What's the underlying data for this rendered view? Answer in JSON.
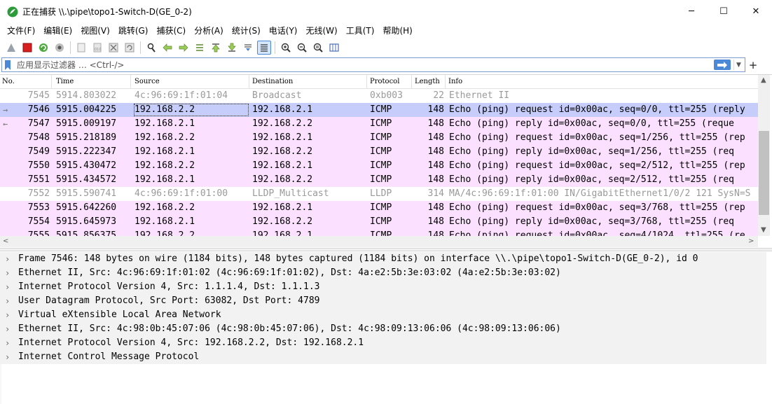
{
  "window": {
    "title": "正在捕获 \\\\.\\pipe\\topo1-Switch-D(GE_0-2)",
    "controls": [
      "─",
      "☐",
      "✕"
    ]
  },
  "menu": [
    "文件(F)",
    "编辑(E)",
    "视图(V)",
    "跳转(G)",
    "捕获(C)",
    "分析(A)",
    "统计(S)",
    "电话(Y)",
    "无线(W)",
    "工具(T)",
    "帮助(H)"
  ],
  "toolbar": {
    "buttons": [
      "start-capture-icon",
      "stop-capture-icon",
      "restart-capture-icon",
      "capture-options-icon",
      "open-file-icon",
      "save-file-icon",
      "close-file-icon",
      "reload-file-icon",
      "find-packet-icon",
      "go-back-icon",
      "go-forward-icon",
      "go-to-packet-icon",
      "go-first-icon",
      "go-last-icon",
      "auto-scroll-icon",
      "colorize-icon",
      "zoom-in-icon",
      "zoom-out-icon",
      "zoom-normal-icon",
      "resize-columns-icon"
    ]
  },
  "filter": {
    "placeholder": "应用显示过滤器 … <Ctrl-/>"
  },
  "packet_list": {
    "columns": [
      "No.",
      "Time",
      "Source",
      "Destination",
      "Protocol",
      "Length",
      "Info"
    ],
    "rows": [
      {
        "no": "7545",
        "time": "5914.803022",
        "src": "4c:96:69:1f:01:04",
        "dst": "Broadcast",
        "proto": "0xb003",
        "len": "22",
        "info": "Ethernet II",
        "style": "faded",
        "marker": ""
      },
      {
        "no": "7546",
        "time": "5915.004225",
        "src": "192.168.2.2",
        "dst": "192.168.2.1",
        "proto": "ICMP",
        "len": "148",
        "info": "Echo (ping) request  id=0x00ac, seq=0/0, ttl=255 (reply",
        "style": "selected",
        "marker": "→"
      },
      {
        "no": "7547",
        "time": "5915.009197",
        "src": "192.168.2.1",
        "dst": "192.168.2.2",
        "proto": "ICMP",
        "len": "148",
        "info": "Echo (ping) reply    id=0x00ac, seq=0/0, ttl=255 (reque",
        "style": "icmp",
        "marker": "←"
      },
      {
        "no": "7548",
        "time": "5915.218189",
        "src": "192.168.2.2",
        "dst": "192.168.2.1",
        "proto": "ICMP",
        "len": "148",
        "info": "Echo (ping) request  id=0x00ac, seq=1/256, ttl=255 (rep",
        "style": "icmp",
        "marker": ""
      },
      {
        "no": "7549",
        "time": "5915.222347",
        "src": "192.168.2.1",
        "dst": "192.168.2.2",
        "proto": "ICMP",
        "len": "148",
        "info": "Echo (ping) reply    id=0x00ac, seq=1/256, ttl=255 (req",
        "style": "icmp",
        "marker": ""
      },
      {
        "no": "7550",
        "time": "5915.430472",
        "src": "192.168.2.2",
        "dst": "192.168.2.1",
        "proto": "ICMP",
        "len": "148",
        "info": "Echo (ping) request  id=0x00ac, seq=2/512, ttl=255 (rep",
        "style": "icmp",
        "marker": ""
      },
      {
        "no": "7551",
        "time": "5915.434572",
        "src": "192.168.2.1",
        "dst": "192.168.2.2",
        "proto": "ICMP",
        "len": "148",
        "info": "Echo (ping) reply    id=0x00ac, seq=2/512, ttl=255 (req",
        "style": "icmp",
        "marker": ""
      },
      {
        "no": "7552",
        "time": "5915.590741",
        "src": "4c:96:69:1f:01:00",
        "dst": "LLDP_Multicast",
        "proto": "LLDP",
        "len": "314",
        "info": "MA/4c:96:69:1f:01:00 IN/GigabitEthernet1/0/2 121 SysN=S",
        "style": "faded2",
        "marker": ""
      },
      {
        "no": "7553",
        "time": "5915.642260",
        "src": "192.168.2.2",
        "dst": "192.168.2.1",
        "proto": "ICMP",
        "len": "148",
        "info": "Echo (ping) request  id=0x00ac, seq=3/768, ttl=255 (rep",
        "style": "icmp",
        "marker": ""
      },
      {
        "no": "7554",
        "time": "5915.645973",
        "src": "192.168.2.1",
        "dst": "192.168.2.2",
        "proto": "ICMP",
        "len": "148",
        "info": "Echo (ping) reply    id=0x00ac, seq=3/768, ttl=255 (req",
        "style": "icmp",
        "marker": ""
      },
      {
        "no": "7555",
        "time": "5915.856375",
        "src": "192.168.2.2",
        "dst": "192.168.2.1",
        "proto": "ICMP",
        "len": "148",
        "info": "Echo (ping) request  id=0x00ac, seq=4/1024, ttl=255 (re",
        "style": "icmp",
        "marker": ""
      }
    ]
  },
  "details": [
    "Frame 7546: 148 bytes on wire (1184 bits), 148 bytes captured (1184 bits) on interface \\\\.\\pipe\\topo1-Switch-D(GE_0-2), id 0",
    "Ethernet II, Src: 4c:96:69:1f:01:02 (4c:96:69:1f:01:02), Dst: 4a:e2:5b:3e:03:02 (4a:e2:5b:3e:03:02)",
    "Internet Protocol Version 4, Src: 1.1.1.4, Dst: 1.1.1.3",
    "User Datagram Protocol, Src Port: 63082, Dst Port: 4789",
    "Virtual eXtensible Local Area Network",
    "Ethernet II, Src: 4c:98:0b:45:07:06 (4c:98:0b:45:07:06), Dst: 4c:98:09:13:06:06 (4c:98:09:13:06:06)",
    "Internet Protocol Version 4, Src: 192.168.2.2, Dst: 192.168.2.1",
    "Internet Control Message Protocol"
  ],
  "colors": {
    "icmp_row": "#fce0ff",
    "selected_row": "#c7cdfa",
    "faded_text": "#9a9a9a",
    "accent": "#4b88d7"
  }
}
